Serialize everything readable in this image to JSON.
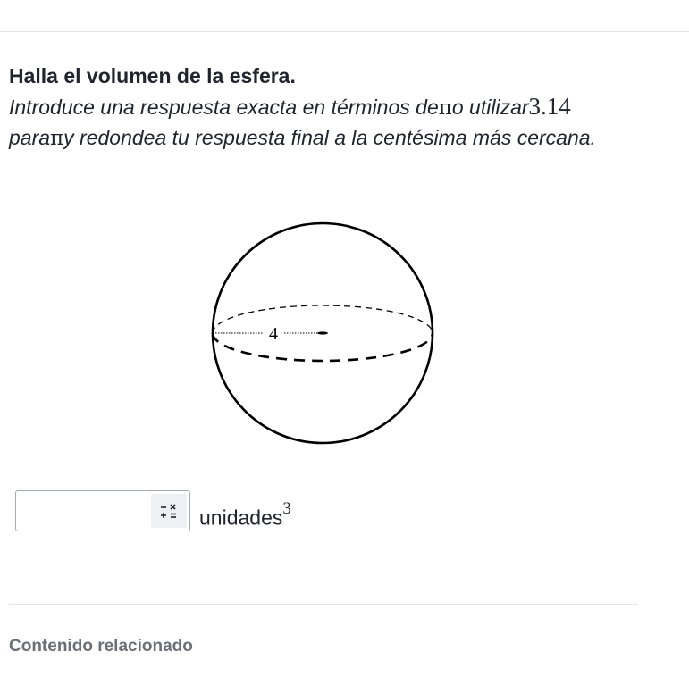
{
  "question": {
    "title": "Halla el volumen de la esfera.",
    "instruction_part1": "Introduce una respuesta exacta en términos de",
    "pi_symbol": "π",
    "instruction_part2": "o utilizar",
    "pi_approx": "3.14",
    "instruction_part3": "para",
    "instruction_part4": "y redondea tu respuesta final a la centésima más cercana."
  },
  "figure": {
    "radius_label": "4"
  },
  "answer": {
    "value": "",
    "placeholder": "",
    "units_label": "unidades",
    "units_exponent": "3",
    "keypad_icon": "math-keypad-icon"
  },
  "footer": {
    "related_label": "Contenido relacionado"
  }
}
